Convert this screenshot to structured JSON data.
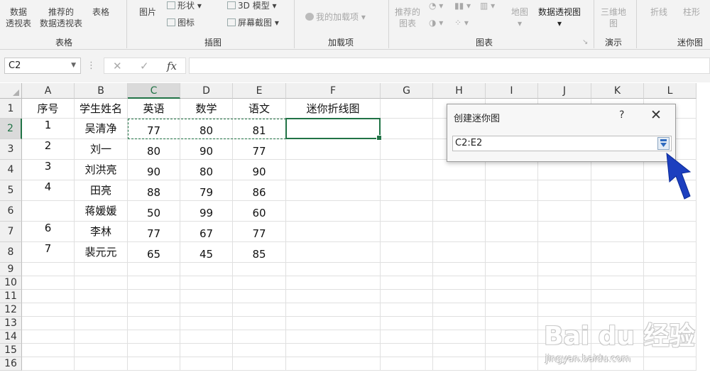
{
  "ribbon": {
    "groups": {
      "tables": "表格",
      "illustrations": "插图",
      "addins": "加载项",
      "charts": "图表",
      "tours": "演示",
      "sparklines": "迷你图"
    },
    "buttons": {
      "pivot_line1": "数据",
      "pivot_line2": "透视表",
      "rec_pivot_line1": "推荐的",
      "rec_pivot_line2": "数据透视表",
      "table": "表格",
      "pictures": "图片",
      "shapes": "形状",
      "icons": "图标",
      "model3d": "3D 模型",
      "screenshot": "屏幕截图",
      "my_addins": "我的加载项",
      "rec_charts_line1": "推荐的",
      "rec_charts_line2": "图表",
      "maps": "地图",
      "pivotchart": "数据透视图",
      "map3d_line1": "三维地",
      "map3d_line2": "图",
      "line": "折线",
      "column": "柱形"
    }
  },
  "formula_bar": {
    "name_box": "C2",
    "fx": "fx",
    "formula": ""
  },
  "sheet": {
    "columns": [
      "A",
      "B",
      "C",
      "D",
      "E",
      "F",
      "G",
      "H",
      "I",
      "J",
      "K",
      "L"
    ],
    "rows": [
      "1",
      "2",
      "3",
      "4",
      "5",
      "6",
      "7",
      "8",
      "9",
      "10",
      "11",
      "12",
      "13",
      "14",
      "15",
      "16"
    ],
    "cells": [
      [
        "序号",
        "学生姓名",
        "英语",
        "数学",
        "语文",
        "迷你折线图"
      ],
      [
        "1",
        "吴清净",
        "77",
        "80",
        "81",
        ""
      ],
      [
        "2",
        "刘一",
        "80",
        "90",
        "77",
        ""
      ],
      [
        "3",
        "刘洪亮",
        "90",
        "80",
        "90",
        ""
      ],
      [
        "4",
        "田亮",
        "88",
        "79",
        "86",
        ""
      ],
      [
        "",
        "蒋媛媛",
        "50",
        "99",
        "60",
        ""
      ],
      [
        "6",
        "李林",
        "77",
        "67",
        "77",
        ""
      ],
      [
        "7",
        "裴元元",
        "65",
        "45",
        "85",
        ""
      ]
    ]
  },
  "dialog": {
    "title": "创建迷你图",
    "help": "?",
    "data_range": "C2:E2"
  },
  "watermark": {
    "text": "Bai du 经验",
    "url": "jingyan.baidu.com"
  }
}
